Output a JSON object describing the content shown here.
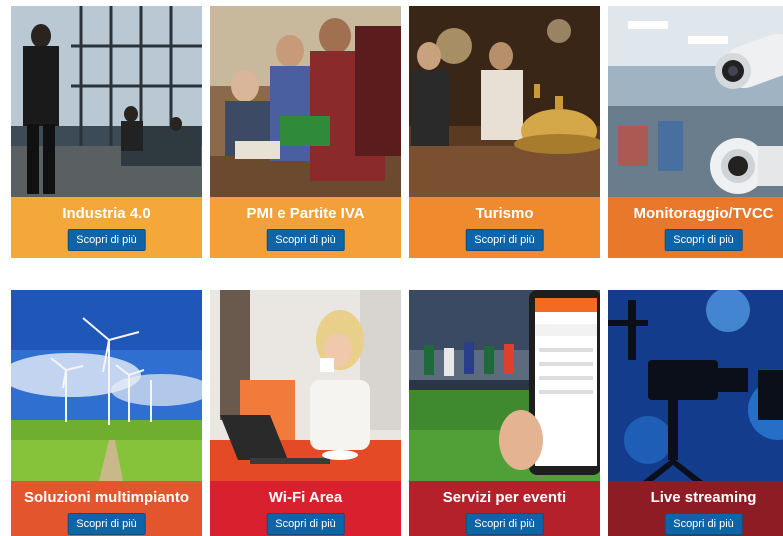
{
  "cards": [
    {
      "title": "Industria 4.0",
      "button": "Scopri di più",
      "color": "#f5a83a"
    },
    {
      "title": "PMI e Partite IVA",
      "button": "Scopri di più",
      "color": "#f3a03a"
    },
    {
      "title": "Turismo",
      "button": "Scopri di più",
      "color": "#ef8a2e"
    },
    {
      "title": "Monitoraggio/TVCC",
      "button": "Scopri di più",
      "color": "#e9782a"
    },
    {
      "title": "Soluzioni multimpianto",
      "button": "Scopri di più",
      "color": "#e2552d"
    },
    {
      "title": "Wi-Fi Area",
      "button": "Scopri di più",
      "color": "#d9202f"
    },
    {
      "title": "Servizi per eventi",
      "button": "Scopri di più",
      "color": "#b5212b"
    },
    {
      "title": "Live streaming",
      "button": "Scopri di più",
      "color": "#8e1c25"
    }
  ]
}
